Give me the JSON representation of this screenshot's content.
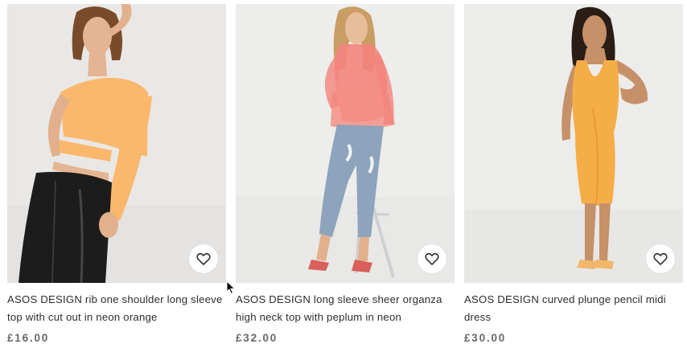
{
  "products": [
    {
      "title": "ASOS DESIGN rib one shoulder long sleeve top with cut out in neon orange",
      "price": "£16.00",
      "colors": {
        "background": "#e9e8e6",
        "garment": "#fbb86c",
        "skirt": "#1c1c1c"
      }
    },
    {
      "title": "ASOS DESIGN long sleeve sheer organza high neck top with peplum in neon",
      "price": "£32.00",
      "colors": {
        "background": "#ededeb",
        "garment": "#f2847c",
        "jeans": "#8ea3bc"
      }
    },
    {
      "title": "ASOS DESIGN curved plunge pencil midi dress",
      "price": "£30.00",
      "colors": {
        "background": "#ececea",
        "garment": "#f5ad47"
      }
    }
  ],
  "icons": {
    "save": "heart-icon",
    "cursor": "mouse-pointer-icon"
  }
}
